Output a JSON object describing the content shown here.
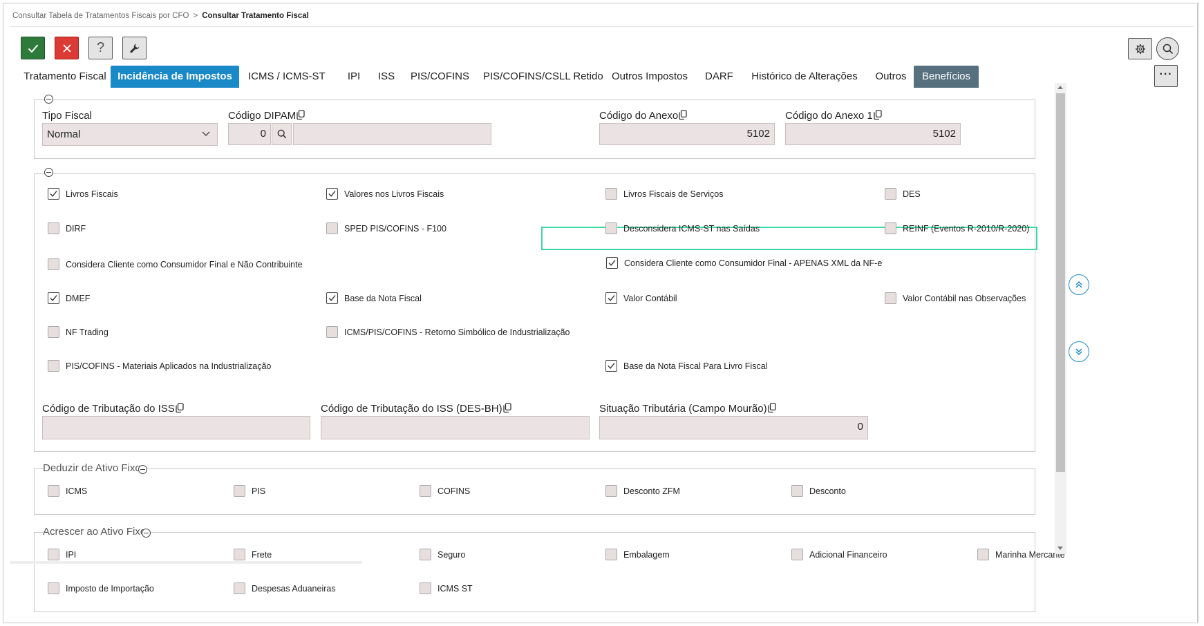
{
  "breadcrumb": {
    "parent": "Consultar Tabela de Tratamentos Fiscais por CFO",
    "separator": ">",
    "current": "Consultar Tratamento Fiscal"
  },
  "toolbar": {
    "help_label": "?",
    "more_label": "···"
  },
  "tabs": [
    {
      "label": "Tratamento Fiscal"
    },
    {
      "label": "Incidência de Impostos"
    },
    {
      "label": "ICMS / ICMS-ST"
    },
    {
      "label": "IPI"
    },
    {
      "label": "ISS"
    },
    {
      "label": "PIS/COFINS"
    },
    {
      "label": "PIS/COFINS/CSLL Retido"
    },
    {
      "label": "Outros Impostos"
    },
    {
      "label": "DARF"
    },
    {
      "label": "Histórico de Alterações"
    },
    {
      "label": "Outros"
    },
    {
      "label": "Benefícios"
    }
  ],
  "header_section": {
    "tipo_fiscal": {
      "label": "Tipo Fiscal",
      "value": "Normal"
    },
    "codigo_dipam": {
      "label": "Código DIPAM",
      "value": "0",
      "description": ""
    },
    "codigo_anexo": {
      "label": "Código do Anexo",
      "value": "5102"
    },
    "codigo_anexo_1": {
      "label": "Código do Anexo 1",
      "value": "5102"
    }
  },
  "incidencia": {
    "checkboxes": [
      {
        "label": "Livros Fiscais",
        "checked": true
      },
      {
        "label": "Valores nos Livros Fiscais",
        "checked": true
      },
      {
        "label": "Livros Fiscais de Serviços",
        "checked": false
      },
      {
        "label": "DES",
        "checked": false
      },
      {
        "label": "DIRF",
        "checked": false
      },
      {
        "label": "SPED PIS/COFINS - F100",
        "checked": false
      },
      {
        "label": "Desconsidera ICMS-ST nas Saídas",
        "checked": false
      },
      {
        "label": "REINF (Eventos R-2010/R-2020)",
        "checked": false
      },
      {
        "label": "Considera Cliente como Consumidor Final e Não Contribuinte",
        "checked": false
      },
      {
        "label": "Considera Cliente como Consumidor Final - APENAS XML da NF-e",
        "checked": true
      },
      {
        "label": "DMEF",
        "checked": true
      },
      {
        "label": "Base da Nota Fiscal",
        "checked": true
      },
      {
        "label": "Valor Contábil",
        "checked": true
      },
      {
        "label": "Valor Contábil nas Observações",
        "checked": false
      },
      {
        "label": "NF Trading",
        "checked": false
      },
      {
        "label": "ICMS/PIS/COFINS - Retorno Simbólico de Industrialização",
        "checked": false
      },
      {
        "label": "PIS/COFINS - Materiais Aplicados na Industrialização",
        "checked": false
      },
      {
        "label": "Base da Nota Fiscal Para Livro Fiscal",
        "checked": true
      }
    ],
    "cod_trib_iss": {
      "label": "Código de Tributação do ISS",
      "value": ""
    },
    "cod_trib_iss_desbh": {
      "label": "Código de Tributação do ISS (DES-BH)",
      "value": ""
    },
    "sit_trib_campo_mourao": {
      "label": "Situação Tributária (Campo Mourão)",
      "value": "0"
    }
  },
  "deduzir": {
    "legend": "Deduzir de Ativo Fixo",
    "checkboxes": [
      {
        "label": "ICMS",
        "checked": false
      },
      {
        "label": "PIS",
        "checked": false
      },
      {
        "label": "COFINS",
        "checked": false
      },
      {
        "label": "Desconto ZFM",
        "checked": false
      },
      {
        "label": "Desconto",
        "checked": false
      }
    ]
  },
  "acrescer": {
    "legend": "Acrescer ao Ativo Fixo",
    "checkboxes": [
      {
        "label": "IPI",
        "checked": false
      },
      {
        "label": "Frete",
        "checked": false
      },
      {
        "label": "Seguro",
        "checked": false
      },
      {
        "label": "Embalagem",
        "checked": false
      },
      {
        "label": "Adicional Financeiro",
        "checked": false
      },
      {
        "label": "Marinha Mercante",
        "checked": false
      },
      {
        "label": "Imposto de Importação",
        "checked": false
      },
      {
        "label": "Despesas Aduaneiras",
        "checked": false
      },
      {
        "label": "ICMS ST",
        "checked": false
      }
    ]
  },
  "colors": {
    "accent": "#1a89c8",
    "confirm": "#2d7a3b",
    "cancel": "#dc3b35",
    "benefits_tab": "#56707f",
    "highlight": "#3fd8a0",
    "field_bg": "#ebe3e3"
  },
  "icons": {
    "confirm": "check-icon",
    "cancel": "close-icon",
    "help": "help-icon",
    "tool": "wrench-icon",
    "settings": "gear-icon",
    "search": "search-icon",
    "copy": "copy-icon",
    "scroll_up": "double-chevron-up-icon",
    "scroll_down": "double-chevron-down-icon"
  }
}
